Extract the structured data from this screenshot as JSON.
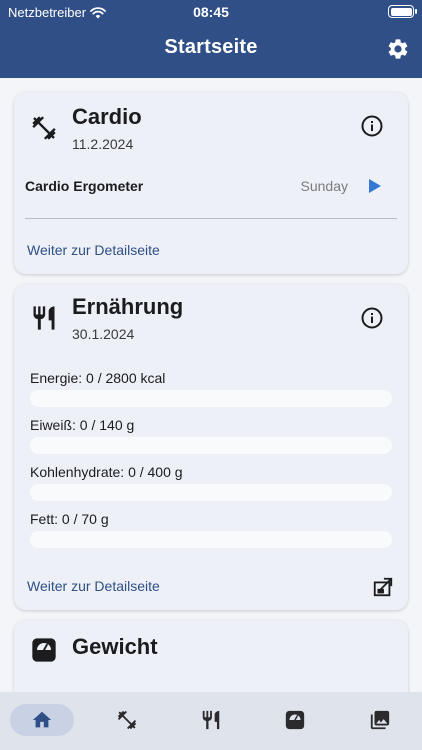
{
  "status_bar": {
    "carrier": "Netzbetreiber",
    "time": "08:45"
  },
  "header": {
    "title": "Startseite"
  },
  "cardio": {
    "title": "Cardio",
    "date": "11.2.2024",
    "exercise": {
      "name": "Cardio Ergometer",
      "day": "Sunday"
    },
    "link": "Weiter zur Detailseite"
  },
  "nutrition": {
    "title": "Ernährung",
    "date": "30.1.2024",
    "items": [
      {
        "label": "Energie: 0 / 2800 kcal",
        "progress": 0
      },
      {
        "label": "Eiweiß: 0 / 140 g",
        "progress": 0
      },
      {
        "label": "Kohlenhydrate: 0 / 400 g",
        "progress": 0
      },
      {
        "label": "Fett: 0 / 70 g",
        "progress": 0
      }
    ],
    "link": "Weiter zur Detailseite"
  },
  "weight": {
    "title": "Gewicht"
  },
  "tabs": [
    {
      "icon": "home-icon",
      "active": true
    },
    {
      "icon": "dumbbell-icon",
      "active": false
    },
    {
      "icon": "utensils-icon",
      "active": false
    },
    {
      "icon": "scale-icon",
      "active": false
    },
    {
      "icon": "photo-library-icon",
      "active": false
    }
  ],
  "colors": {
    "primary": "#2f4f86",
    "card": "#edf0f7",
    "link": "#2f4f86",
    "play": "#3478d4"
  }
}
